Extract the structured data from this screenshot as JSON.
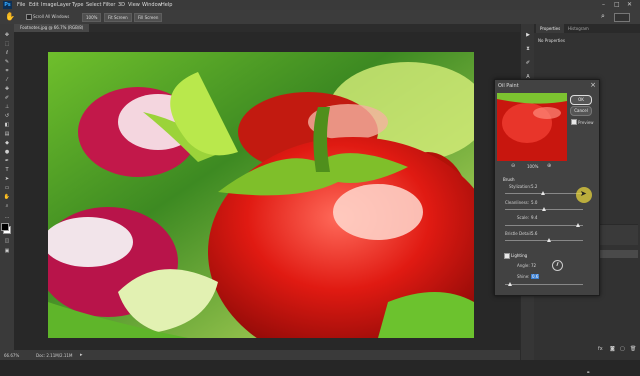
{
  "app": {
    "logo": "Ps"
  },
  "menu": [
    "File",
    "Edit",
    "Image",
    "Layer",
    "Type",
    "Select",
    "Filter",
    "3D",
    "View",
    "Window",
    "Help"
  ],
  "options_bar": {
    "scroll_all_windows": "Scroll All Windows",
    "zoom_pct": "100%",
    "fit_screen": "Fit Screen",
    "fill_screen": "Fill Screen"
  },
  "document": {
    "tab_title": "Footnotes.jpg @ 66.7% (RGB/8)"
  },
  "status": {
    "zoom": "66.67%",
    "doc_size": "Doc: 2.11M/2.11M"
  },
  "panels": {
    "properties_tab": "Properties",
    "histogram_tab": "Histogram",
    "no_properties": "No Properties"
  },
  "dialog": {
    "title": "Oil Paint",
    "ok": "OK",
    "cancel": "Cancel",
    "preview": "Preview",
    "preview_checked": true,
    "zoom_pct": "100%",
    "brush_section": "Brush",
    "stylization": {
      "label": "Stylization:",
      "value": "5.2",
      "pos": 0.49
    },
    "cleanliness": {
      "label": "Cleanliness:",
      "value": "5.0",
      "pos": 0.5
    },
    "scale": {
      "label": "Scale:",
      "value": "9.4",
      "pos": 0.93
    },
    "bristle_detail": {
      "label": "Bristle Detail:",
      "value": "5.6",
      "pos": 0.56
    },
    "lighting_section": "Lighting",
    "lighting_checked": true,
    "angle": {
      "label": "Angle:",
      "value": "72"
    },
    "shine": {
      "label": "Shine:",
      "value": "0.6",
      "pos": 0.06
    }
  },
  "icons": {
    "ps_logo": "photoshop-logo-icon",
    "hand": "hand-tool-icon",
    "angle_dial": "angle-dial-icon"
  },
  "colors": {
    "accent": "#31a8ff",
    "panel_bg": "#3a3a3a",
    "workspace_bg": "#282828"
  }
}
